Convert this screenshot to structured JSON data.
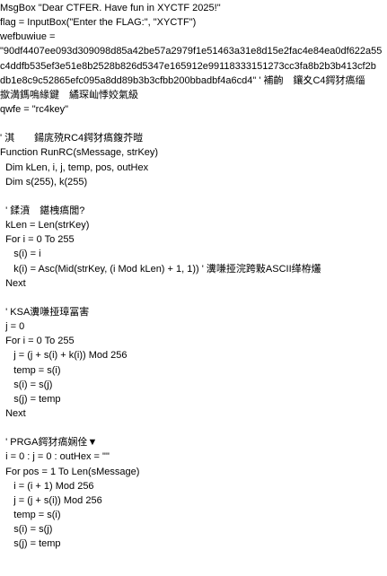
{
  "lines": [
    "MsgBox \"Dear CTFER. Have fun in XYCTF 2025!\"",
    "flag = InputBox(\"Enter the FLAG:\", \"XYCTF\")",
    "wefbuwiue =",
    "\"90df4407ee093d309098d85a42be57a2979f1e51463a31e8d15e2fac4e84ea0df622a55",
    "c4ddfb535ef3e51e8b2528b826d5347e165912e99118333151273cc3fa8b2b3b413cf2b",
    "db1e8c9c52865efc095a8dd89b3b3cfbb200bbadbf4a6cd4\" ' 補齣　鑲夊C4鍔犲瘑缁",
    "撳満鎷嗚緣鍵　繘琛屾悸姣氣級",
    "qwfe = \"rc4key\"",
    "",
    "' 淇　　鍚庣殑RC4鍔犲瘑鍑芥暟",
    "Function RunRC(sMessage, strKey)",
    "  Dim kLen, i, j, temp, pos, outHex",
    "  Dim s(255), k(255)",
    "",
    "  ' 鍒濆　鍖栧瘑閭?",
    "  kLen = Len(strKey)",
    "  For i = 0 To 255",
    "     s(i) = i",
    "     k(i) = Asc(Mid(strKey, (i Mod kLen) + 1, 1)) ' 瀵嗛挜浣跨敤ASCII缂栫爜",
    "  Next",
    "",
    "  ' KSA瀵嗛挜璋冨害",
    "  j = 0",
    "  For i = 0 To 255",
    "     j = (j + s(i) + k(i)) Mod 256",
    "     temp = s(i)",
    "     s(i) = s(j)",
    "     s(j) = temp",
    "  Next",
    "",
    "  ' PRGA鍔犲瘑娴佺▼",
    "  i = 0 : j = 0 : outHex = \"\"",
    "  For pos = 1 To Len(sMessage)",
    "     i = (i + 1) Mod 256",
    "     j = (j + s(i)) Mod 256",
    "     temp = s(i)",
    "     s(i) = s(j)",
    "     s(j) = temp"
  ]
}
